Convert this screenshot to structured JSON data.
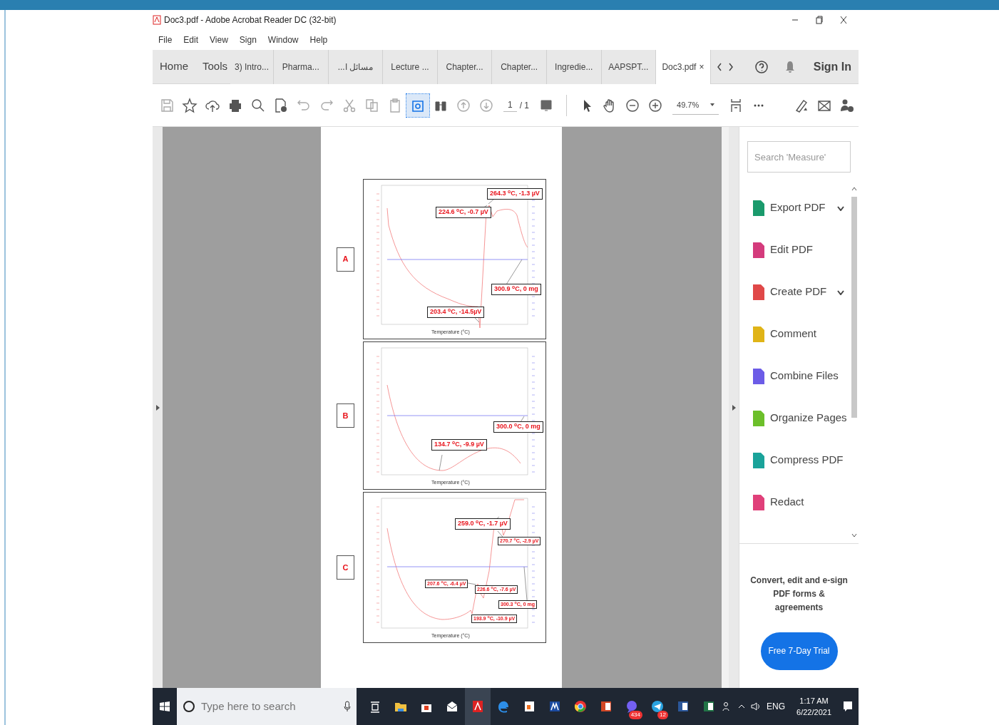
{
  "window": {
    "title": "Doc3.pdf - Adobe Acrobat Reader DC (32-bit)"
  },
  "menu": [
    "File",
    "Edit",
    "View",
    "Sign",
    "Window",
    "Help"
  ],
  "nav": {
    "home": "Home",
    "tools": "Tools",
    "sign_in": "Sign In"
  },
  "tabs": [
    {
      "label": "3) Intro...",
      "selected": false
    },
    {
      "label": "Pharma...",
      "selected": false
    },
    {
      "label": "مسائل ا...",
      "selected": false
    },
    {
      "label": "Lecture ...",
      "selected": false
    },
    {
      "label": "Chapter...",
      "selected": false
    },
    {
      "label": "Chapter...",
      "selected": false
    },
    {
      "label": "Ingredie...",
      "selected": false
    },
    {
      "label": "AAPSPT...",
      "selected": false
    },
    {
      "label": "Doc3.pdf",
      "selected": true,
      "close": "×"
    }
  ],
  "toolbar": {
    "page_current": "1",
    "page_total": "/ 1",
    "zoom": "49.7%"
  },
  "document": {
    "panels": [
      {
        "letter": "A",
        "xlabel": "Temperature (°C)",
        "annotations": [
          "264.3 $^{o}$C, -1.3 µV",
          "224.6 $^{o}$C, -0.7 µV",
          "300.9 $^{o}$C, 0 mg",
          "203.4 $^{o}$C, -14.5µV"
        ]
      },
      {
        "letter": "B",
        "xlabel": "Temperature (°C)",
        "annotations": [
          "300.0 $^{o}$C, 0 mg",
          "134.7 $^{o}$C, -9.9 µV"
        ]
      },
      {
        "letter": "C",
        "xlabel": "Temperature (°C)",
        "annotations": [
          "259.0 $^{o}$C, -1.7 µV",
          "270.7 $^{o}$C, -2.9 µV",
          "207.6 $^{o}$C, -6.4 µV",
          "226.6 $^{o}$C, -7.6 µV",
          "300.3 $^{o}$C, 0 mg",
          "193.9 $^{o}$C, -10.9 µV"
        ]
      }
    ]
  },
  "tools_pane": {
    "search": {
      "placeholder": "Search 'Measure'"
    },
    "items": [
      {
        "label": "Export PDF",
        "expandable": true,
        "color": "#1a9a6c"
      },
      {
        "label": "Edit PDF",
        "expandable": false,
        "color": "#d43b7c"
      },
      {
        "label": "Create PDF",
        "expandable": true,
        "color": "#e04848"
      },
      {
        "label": "Comment",
        "expandable": false,
        "color": "#e0b417"
      },
      {
        "label": "Combine Files",
        "expandable": false,
        "color": "#6c5ce7"
      },
      {
        "label": "Organize Pages",
        "expandable": false,
        "color": "#6cbf2a"
      },
      {
        "label": "Compress PDF",
        "expandable": false,
        "color": "#1aa39a"
      },
      {
        "label": "Redact",
        "expandable": false,
        "color": "#e0407a"
      }
    ],
    "promo": "Convert, edit and e-sign PDF forms & agreements",
    "trial_button": "Free 7-Day Trial"
  },
  "taskbar": {
    "search_placeholder": "Type here to search",
    "badges": [
      "434",
      "12"
    ],
    "language": "ENG",
    "time": "1:17 AM",
    "date": "6/22/2021"
  }
}
